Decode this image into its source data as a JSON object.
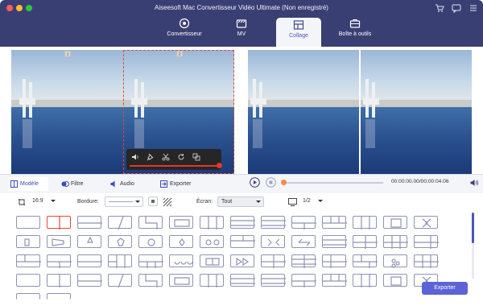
{
  "window": {
    "title": "Aiseesoft Mac Convertisseur Vidéo Ultimate (Non enregistré)",
    "traffic_lights": [
      "#fe5f57",
      "#febc2e",
      "#28c840"
    ]
  },
  "header_icons": [
    "cart-icon",
    "chat-icon",
    "menu-icon"
  ],
  "nav": {
    "tabs": [
      {
        "label": "Convertisseur",
        "icon": "convert-icon",
        "active": false
      },
      {
        "label": "MV",
        "icon": "mv-icon",
        "active": false
      },
      {
        "label": "Collage",
        "icon": "collage-icon",
        "active": true
      },
      {
        "label": "Boîte à outils",
        "icon": "toolbox-icon",
        "active": false
      }
    ]
  },
  "preview": {
    "slot_labels": [
      "1",
      "2"
    ]
  },
  "edit_toolbar": {
    "icons": [
      "volume-icon",
      "pin-icon",
      "cut-icon",
      "rotate-icon",
      "copy-icon"
    ],
    "volume_progress": 1.0
  },
  "bottom_tabs": [
    {
      "label": "Modèle",
      "icon": "template-icon",
      "active": true
    },
    {
      "label": "Filtre",
      "icon": "filter-icon",
      "active": false
    },
    {
      "label": "Audio",
      "icon": "audio-icon",
      "active": false
    },
    {
      "label": "Exporter",
      "icon": "export-icon",
      "active": false
    }
  ],
  "playback": {
    "timecode": "00:00:00.00/00:00:04.06",
    "progress": 0.0
  },
  "options": {
    "aspect": "16:9",
    "border_label": "Bordure:",
    "screen_label": "Écran:",
    "screen_value": "Tout",
    "pages": "1/2"
  },
  "export_button": "Exporter",
  "colors": {
    "header": "#3a3f73",
    "accent": "#5b63d6",
    "selection": "#e04a3b"
  }
}
